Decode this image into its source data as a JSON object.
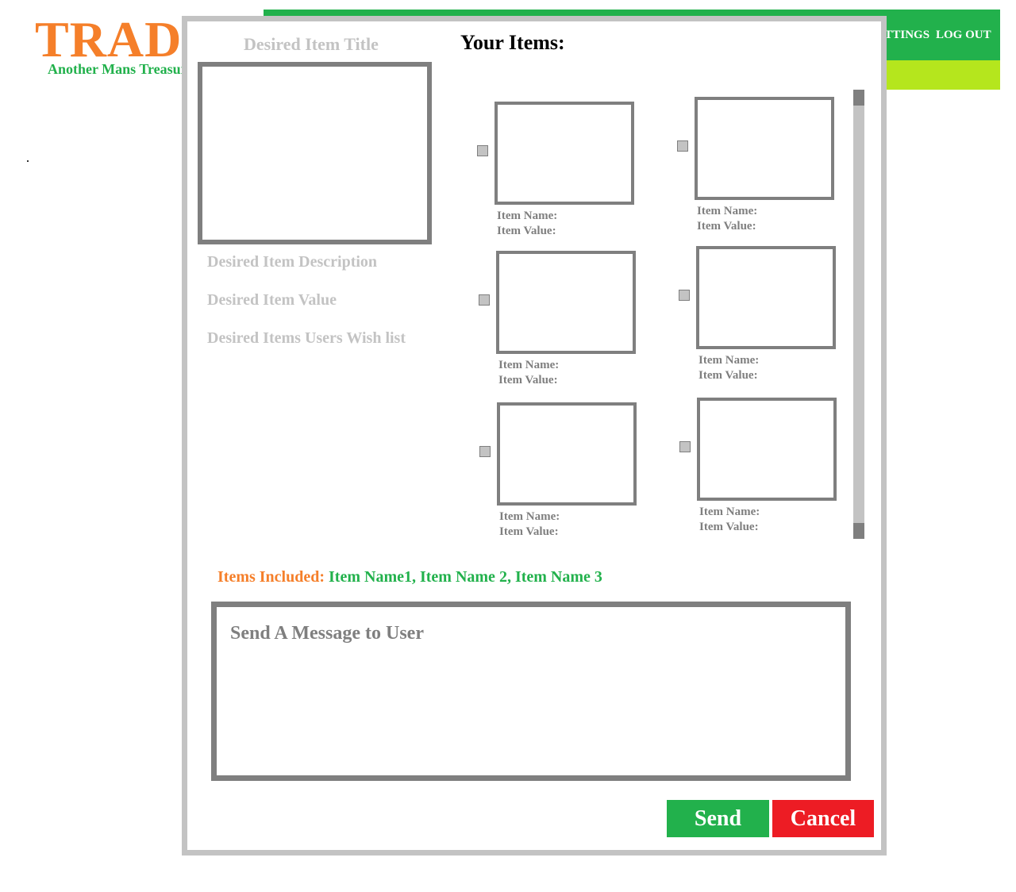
{
  "brand": {
    "logo_text": "TRADE",
    "tagline": "Another Mans Treasure"
  },
  "nav": {
    "settings": "SETTINGS",
    "logout": "LOG OUT"
  },
  "modal": {
    "desired_item_title": "Desired Item Title",
    "your_items_heading": "Your Items:",
    "desired_item_description": "Desired Item Description",
    "desired_item_value": "Desired Item Value",
    "desired_items_wishlist": "Desired Items Users Wish list",
    "items": [
      {
        "name_label": "Item Name:",
        "value_label": "Item Value:"
      },
      {
        "name_label": "Item Name:",
        "value_label": "Item Value:"
      },
      {
        "name_label": "Item Name:",
        "value_label": "Item Value:"
      },
      {
        "name_label": "Item Name:",
        "value_label": "Item Value:"
      },
      {
        "name_label": "Item Name:",
        "value_label": "Item Value:"
      },
      {
        "name_label": "Item Name:",
        "value_label": "Item Value:"
      }
    ],
    "items_included_label": "Items Included:",
    "items_included_value": "Item Name1, Item Name 2, Item Name 3",
    "message_placeholder": "Send A Message to User",
    "send_label": "Send",
    "cancel_label": "Cancel"
  },
  "colors": {
    "brand_orange": "#f57f2a",
    "brand_green": "#22b14c",
    "accent_lime": "#b5e61d",
    "cancel_red": "#ed1c24",
    "frame_gray": "#7f7f7f",
    "muted_gray": "#c3c3c3"
  }
}
